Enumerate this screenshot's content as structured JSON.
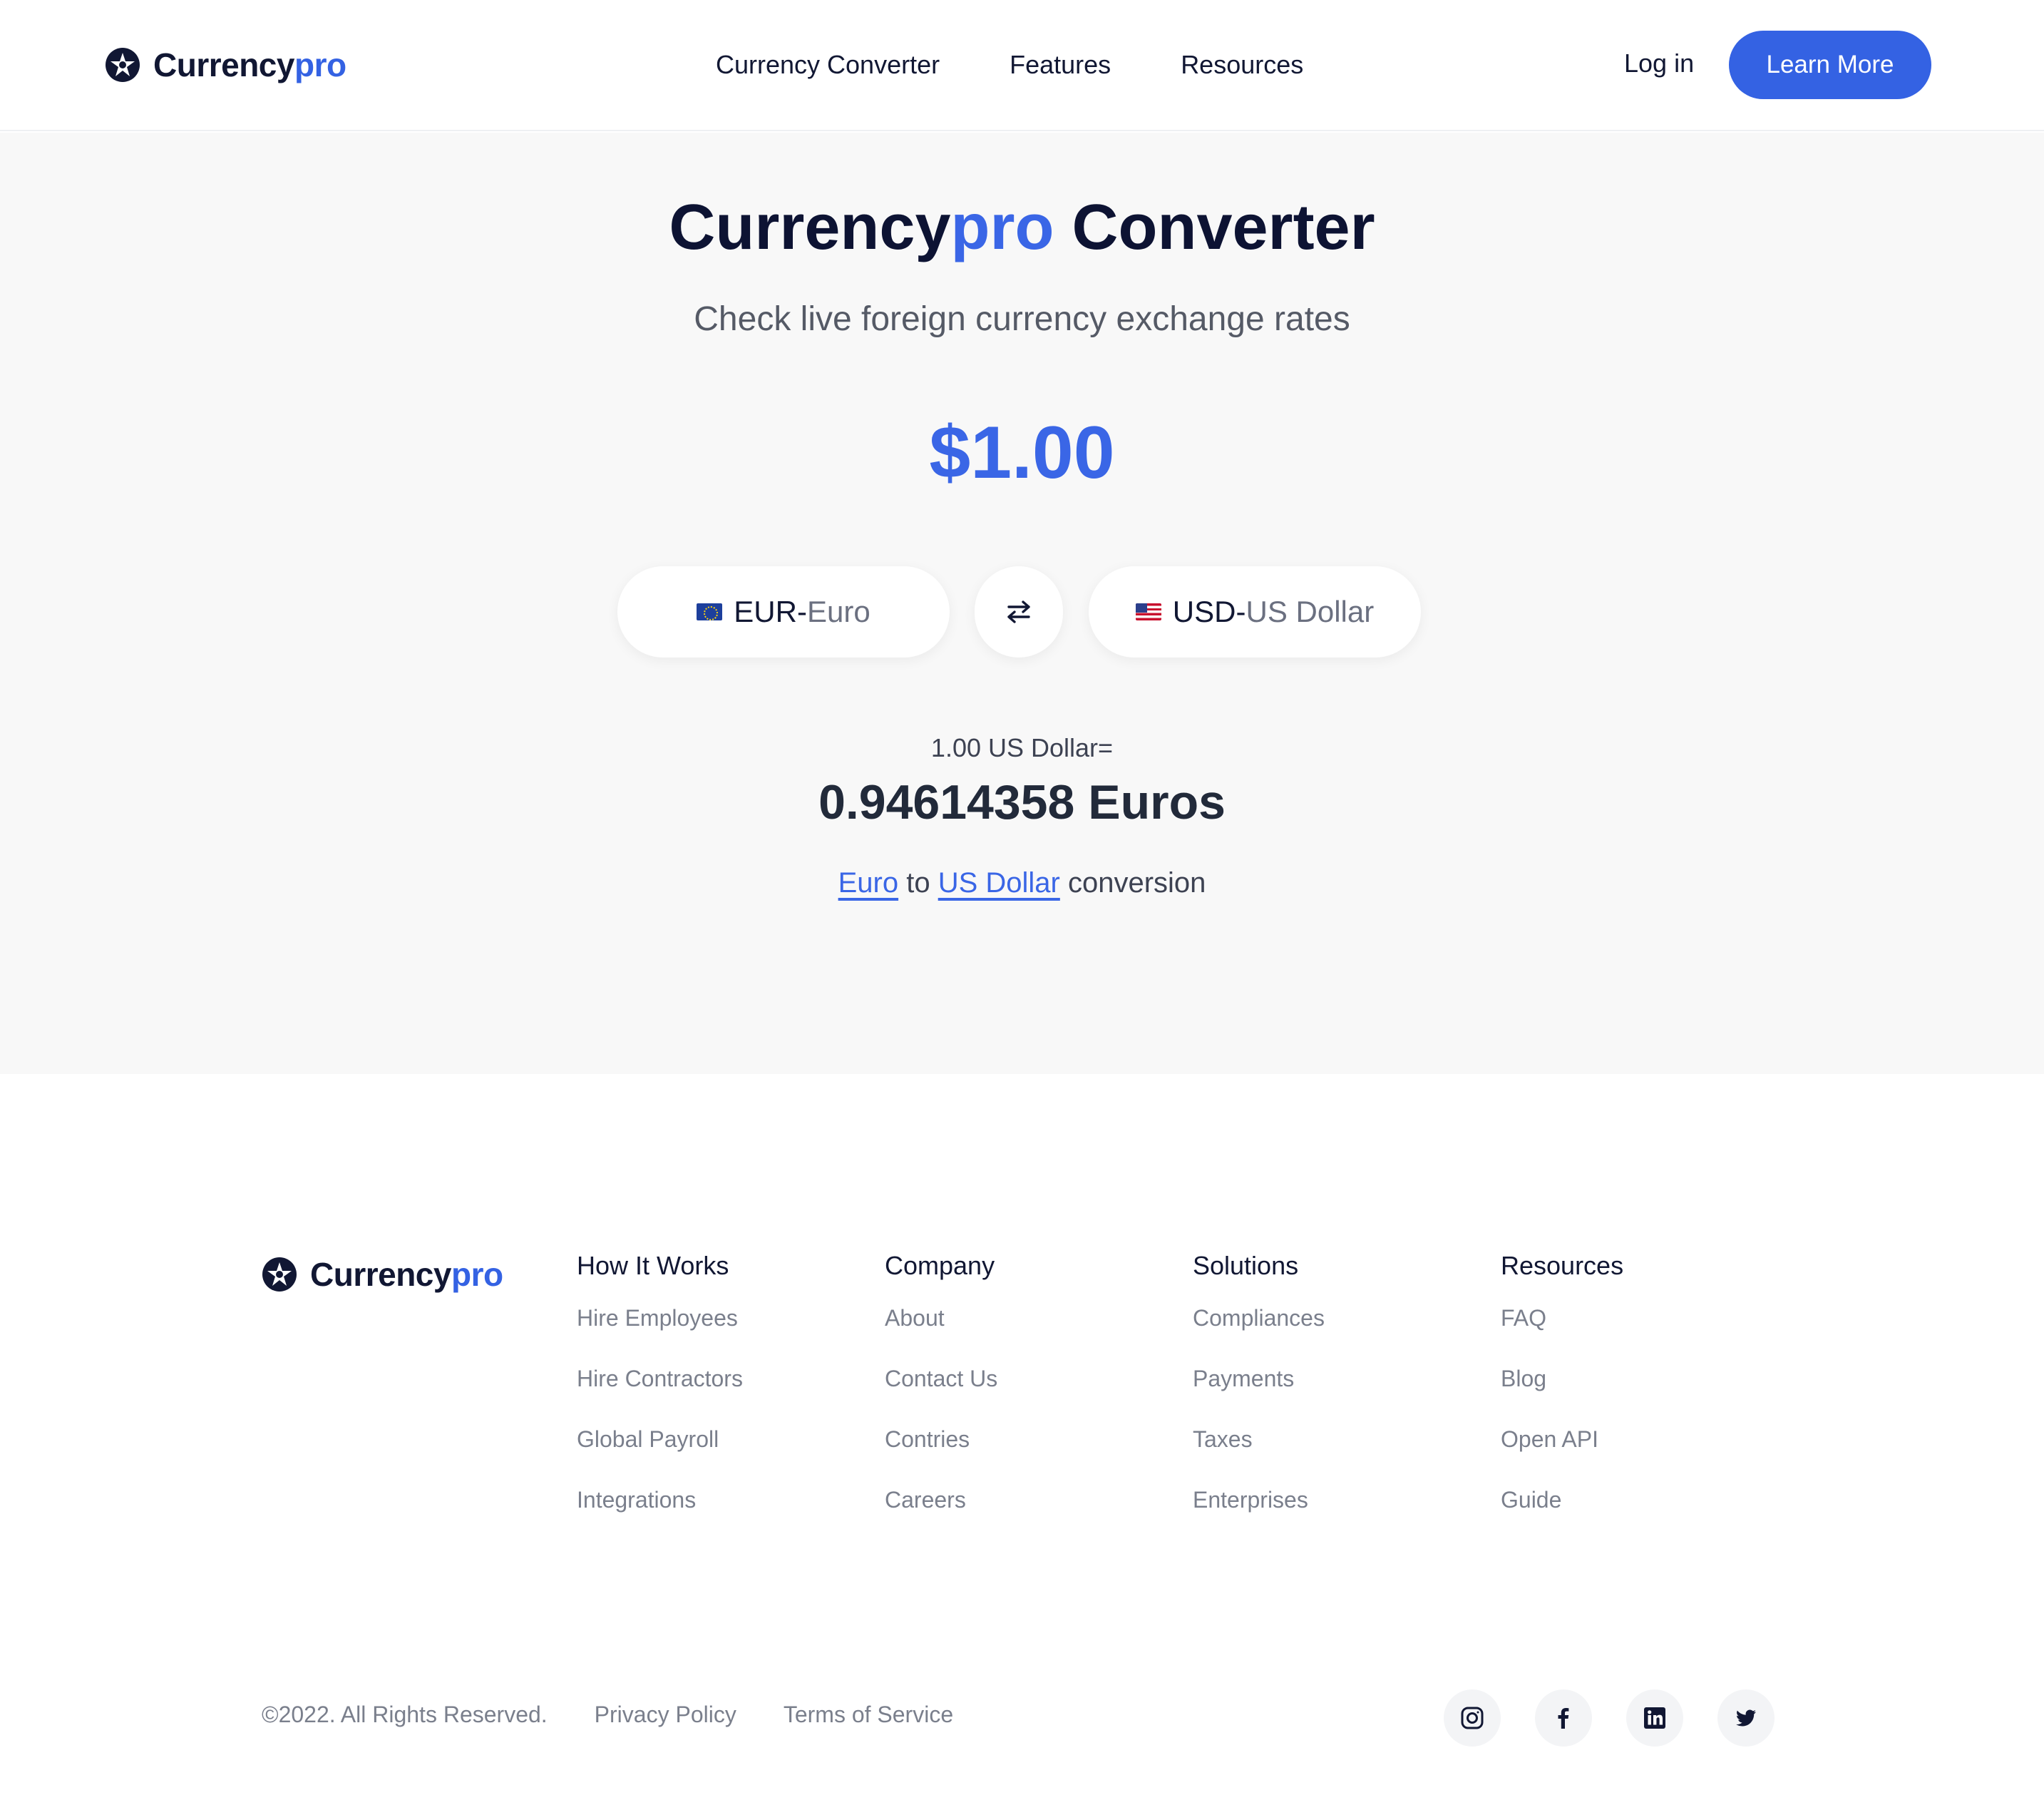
{
  "brand": {
    "name_main": "Currency",
    "name_accent": "pro"
  },
  "nav": {
    "items": [
      "Currency Converter",
      "Features",
      "Resources"
    ],
    "login": "Log in",
    "cta": "Learn More"
  },
  "hero": {
    "title_main": "Currency",
    "title_accent": "pro",
    "title_rest": " Converter",
    "subtitle": "Check live foreign currency exchange rates",
    "amount": "$1.00",
    "from": {
      "code": "EUR",
      "separator": "-",
      "name": "Euro",
      "flag": "eu-flag"
    },
    "to": {
      "code": "USD",
      "separator": "-",
      "name": "US Dollar",
      "flag": "us-flag"
    },
    "swap_icon": "swap-arrows-icon",
    "rate_label": "1.00 US Dollar=",
    "rate_value": "0.94614358 Euros",
    "conversion": {
      "from_link": "Euro",
      "middle": " to ",
      "to_link": "US Dollar",
      "suffix": " conversion"
    }
  },
  "footer": {
    "columns": [
      {
        "title": "How It Works",
        "links": [
          "Hire Employees",
          "Hire Contractors",
          "Global Payroll",
          "Integrations"
        ]
      },
      {
        "title": "Company",
        "links": [
          "About",
          "Contact Us",
          "Contries",
          "Careers"
        ]
      },
      {
        "title": "Solutions",
        "links": [
          "Compliances",
          "Payments",
          "Taxes",
          "Enterprises"
        ]
      },
      {
        "title": "Resources",
        "links": [
          "FAQ",
          "Blog",
          "Open API",
          "Guide"
        ]
      }
    ],
    "copyright": "©2022. All Rights Reserved.",
    "privacy": "Privacy Policy",
    "terms": "Terms of Service",
    "social": [
      "instagram-icon",
      "facebook-icon",
      "linkedin-icon",
      "twitter-icon"
    ]
  },
  "colors": {
    "accent": "#3462e3",
    "text": "#111733",
    "muted": "#7a7f8c",
    "hero_bg": "#f8f8f8"
  }
}
